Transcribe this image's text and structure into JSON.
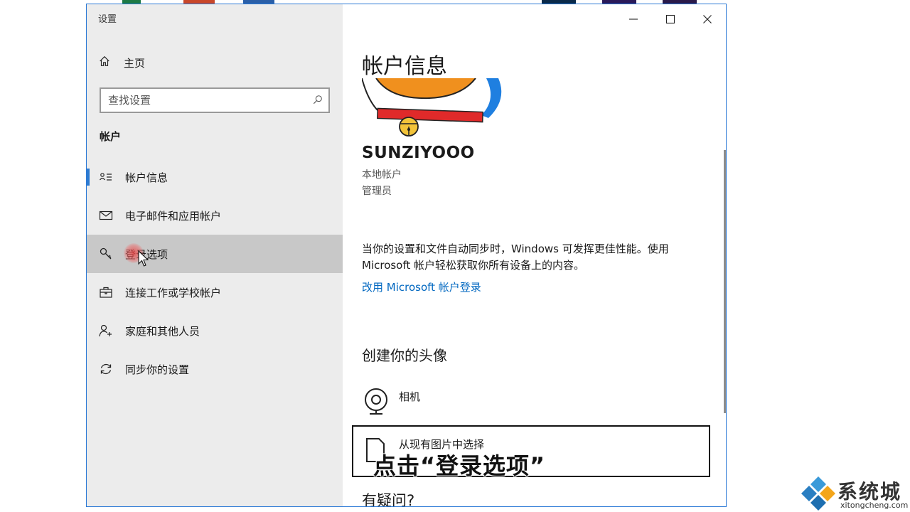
{
  "window": {
    "title": "设置"
  },
  "sidebar": {
    "home_label": "主页",
    "search_placeholder": "查找设置",
    "section_title": "帐户",
    "items": [
      {
        "label": "帐户信息",
        "icon": "account-info-icon",
        "selected": true
      },
      {
        "label": "电子邮件和应用帐户",
        "icon": "mail-icon"
      },
      {
        "label": "登录选项",
        "icon": "key-icon",
        "hovered": true
      },
      {
        "label": "连接工作或学校帐户",
        "icon": "briefcase-icon"
      },
      {
        "label": "家庭和其他人员",
        "icon": "add-person-icon"
      },
      {
        "label": "同步你的设置",
        "icon": "sync-icon"
      }
    ]
  },
  "main": {
    "title": "帐户信息",
    "username": "SUNZIYOOO",
    "account_type": "本地帐户",
    "account_role": "管理员",
    "description": "当你的设置和文件自动同步时，Windows 可发挥更佳性能。使用 Microsoft 帐户轻松获取你所有设备上的内容。",
    "switch_link": "改用 Microsoft 帐户登录",
    "create_avatar_title": "创建你的头像",
    "camera_label": "相机",
    "browse_label": "从现有图片中选择",
    "question": "有疑问?"
  },
  "overlay": {
    "subtitle": "点击“登录选项”",
    "watermark_name": "系统城",
    "watermark_url": "xitongcheng.com"
  },
  "colors": {
    "accent": "#2d7bd1",
    "link": "#0067c0",
    "sidebar_bg": "#ececec",
    "hover_bg": "#c8c8c8"
  }
}
